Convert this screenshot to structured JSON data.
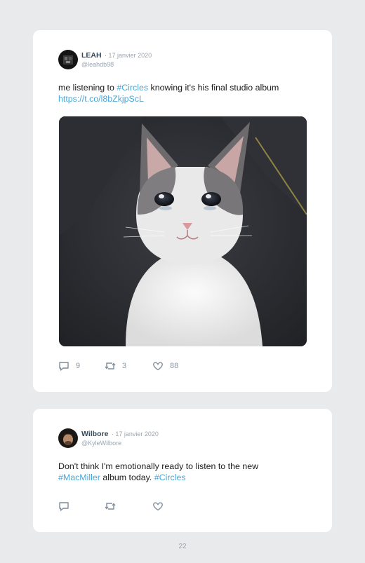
{
  "tweets": [
    {
      "author": "LEAH",
      "date": "· 17 janvier 2020",
      "handle": "@leahdb98",
      "text": {
        "part1": "me listening to ",
        "hashtag1": "#Circles",
        "part2": " knowing it's his final studio album",
        "url": "https://t.co/l8bZkjpScL"
      },
      "image": "crying-cat-photo",
      "stats": {
        "replies": "9",
        "retweets": "3",
        "likes": "88"
      }
    },
    {
      "author": "Wilbore",
      "date": "· 17 janvier 2020",
      "handle": "@KyleWilbore",
      "text": {
        "part1": "Don't think I'm emotionally ready to listen to the new ",
        "hashtag1": "#MacMiller",
        "part2": " album today. ",
        "hashtag2": "#Circles"
      },
      "stats": {
        "replies": "",
        "retweets": "",
        "likes": ""
      }
    }
  ],
  "icons": {
    "reply": "reply-icon",
    "retweet": "retweet-icon",
    "like": "heart-icon"
  },
  "colors": {
    "link": "#49a6d8",
    "name": "#33475a",
    "muted": "#9aa5b1"
  },
  "page_number": "22"
}
